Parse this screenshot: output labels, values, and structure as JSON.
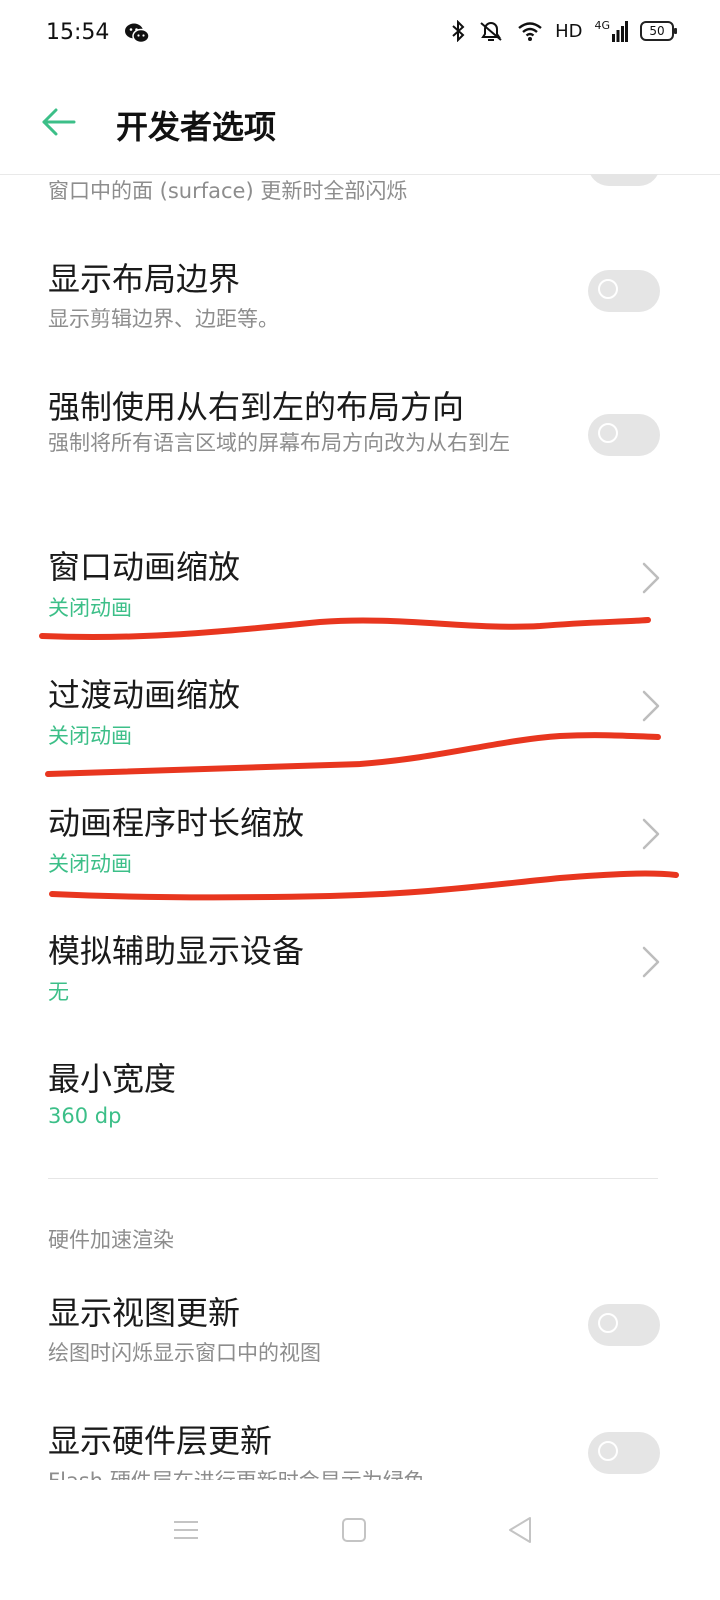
{
  "status": {
    "time": "15:54",
    "network": "HD",
    "signal": "4G",
    "battery": "50"
  },
  "appbar": {
    "title": "开发者选项"
  },
  "rows": {
    "partial_summary": "窗口中的面 (surface) 更新时全部闪烁",
    "layout_bounds": {
      "title": "显示布局边界",
      "summary": "显示剪辑边界、边距等。"
    },
    "rtl": {
      "title": "强制使用从右到左的布局方向",
      "summary": "强制将所有语言区域的屏幕布局方向改为从右到左"
    },
    "window_anim": {
      "title": "窗口动画缩放",
      "value": "关闭动画"
    },
    "transition_anim": {
      "title": "过渡动画缩放",
      "value": "关闭动画"
    },
    "animator_duration": {
      "title": "动画程序时长缩放",
      "value": "关闭动画"
    },
    "secondary_display": {
      "title": "模拟辅助显示设备",
      "value": "无"
    },
    "smallest_width": {
      "title": "最小宽度",
      "value": "360 dp"
    },
    "hw_section": "硬件加速渲染",
    "view_updates": {
      "title": "显示视图更新",
      "summary": "绘图时闪烁显示窗口中的视图"
    },
    "hw_layers": {
      "title": "显示硬件层更新",
      "summary": "Flash 硬件层在进行更新时会显示为绿色"
    }
  },
  "toggles": {
    "partial": false,
    "layout_bounds": false,
    "rtl": false,
    "view_updates": false,
    "hw_layers": false
  },
  "colors": {
    "accent": "#3cbf88",
    "annotation": "#e8361f"
  },
  "icons": {
    "back": "back-arrow-icon",
    "chevron": "chevron-right-icon",
    "nav_menu": "menu-icon",
    "nav_home": "home-icon",
    "nav_back": "back-triangle-icon"
  }
}
